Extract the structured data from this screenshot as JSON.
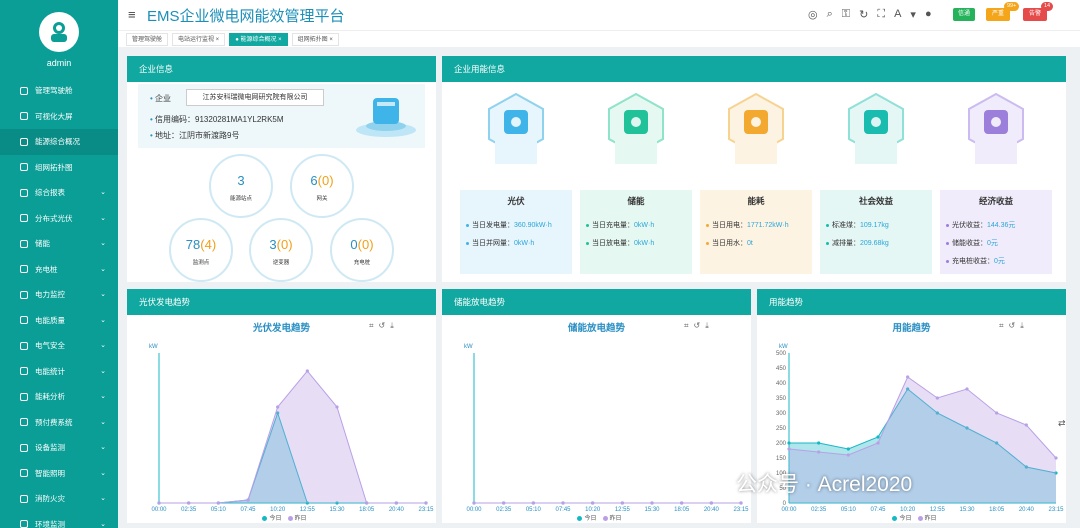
{
  "app": {
    "title": "EMS企业微电网能效管理平台",
    "user": "admin"
  },
  "top": {
    "btn_green": "信通",
    "btn_orange": "严重",
    "btn_red": "告警",
    "badge_orange": "99+",
    "badge_red": "14"
  },
  "sidebar": [
    {
      "label": "管理驾驶舱"
    },
    {
      "label": "可视化大屏"
    },
    {
      "label": "能源综合概况",
      "active": true
    },
    {
      "label": "组网拓扑图"
    },
    {
      "label": "综合报表",
      "caret": true
    },
    {
      "label": "分布式光伏",
      "caret": true
    },
    {
      "label": "储能",
      "caret": true
    },
    {
      "label": "充电桩",
      "caret": true
    },
    {
      "label": "电力监控",
      "caret": true
    },
    {
      "label": "电能质量",
      "caret": true
    },
    {
      "label": "电气安全",
      "caret": true
    },
    {
      "label": "电能统计",
      "caret": true
    },
    {
      "label": "能耗分析",
      "caret": true
    },
    {
      "label": "预付费系统",
      "caret": true
    },
    {
      "label": "设备监测",
      "caret": true
    },
    {
      "label": "智能照明",
      "caret": true
    },
    {
      "label": "消防火灾",
      "caret": true
    },
    {
      "label": "环境监测",
      "caret": true
    }
  ],
  "tabs": [
    {
      "label": "管理驾驶舱"
    },
    {
      "label": "电站运行监视 ×"
    },
    {
      "label": "● 能源综合概况 ×",
      "active": true
    },
    {
      "label": "组网拓扑图 ×"
    }
  ],
  "company": {
    "panel_title": "企业信息",
    "label": "企业",
    "name": "江苏安科瑞微电网研究院有限公司",
    "credit": "信用编码：91320281MA1YL2RK5M",
    "address": "地址：江阴市新渡路9号"
  },
  "stats": [
    {
      "value": "3",
      "sub": "",
      "label": "能源站点"
    },
    {
      "value": "6",
      "sub": "0",
      "label": "网关"
    },
    {
      "value": "78",
      "sub": "4",
      "label": "监测点"
    },
    {
      "value": "3",
      "sub": "0",
      "label": "逆变器"
    },
    {
      "value": "0",
      "sub": "0",
      "label": "充电桩"
    }
  ],
  "energy": {
    "panel_title": "企业用能信息",
    "cards": [
      {
        "title": "光伏",
        "rows": [
          {
            "k": "当日发电量：",
            "v": "360.90kW·h"
          },
          {
            "k": "当日并网量：",
            "v": "0kW·h"
          }
        ]
      },
      {
        "title": "储能",
        "rows": [
          {
            "k": "当日充电量：",
            "v": "0kW·h"
          },
          {
            "k": "当日放电量：",
            "v": "0kW·h"
          }
        ]
      },
      {
        "title": "能耗",
        "rows": [
          {
            "k": "当日用电：",
            "v": "1771.72kW·h"
          },
          {
            "k": "当日用水：",
            "v": "0t"
          }
        ]
      },
      {
        "title": "社会效益",
        "rows": [
          {
            "k": "标准煤：",
            "v": "109.17kg"
          },
          {
            "k": "减排量：",
            "v": "209.68kg"
          }
        ]
      },
      {
        "title": "经济收益",
        "rows": [
          {
            "k": "光伏收益：",
            "v": "144.36元"
          },
          {
            "k": "储能收益：",
            "v": "0元"
          },
          {
            "k": "充电桩收益：",
            "v": "0元"
          }
        ]
      }
    ]
  },
  "panels": {
    "pv": "光伏发电趋势",
    "storage": "储能放电趋势",
    "usage": "用能趋势"
  },
  "watermark": "公众号 · Acrel2020",
  "chart_data": [
    {
      "type": "area",
      "title": "光伏发电趋势",
      "ylabel": "kW",
      "ylim": [
        0,
        250
      ],
      "x": [
        "00:00",
        "02:35",
        "05:10",
        "07:45",
        "10:20",
        "12:55",
        "15:30",
        "18:05",
        "20:40",
        "23:15"
      ],
      "series": [
        {
          "name": "今日",
          "values": [
            0,
            0,
            0,
            5,
            150,
            0,
            0,
            0,
            0,
            0
          ]
        },
        {
          "name": "昨日",
          "values": [
            0,
            0,
            0,
            5,
            160,
            220,
            160,
            0,
            0,
            0
          ]
        }
      ]
    },
    {
      "type": "area",
      "title": "储能放电趋势",
      "ylabel": "kW",
      "ylim": [
        0,
        1
      ],
      "x": [
        "00:00",
        "02:35",
        "05:10",
        "07:45",
        "10:20",
        "12:55",
        "15:30",
        "18:05",
        "20:40",
        "23:15"
      ],
      "series": [
        {
          "name": "今日",
          "values": [
            0,
            0,
            0,
            0,
            0,
            0,
            0,
            0,
            0,
            0
          ]
        },
        {
          "name": "昨日",
          "values": [
            0,
            0,
            0,
            0,
            0,
            0,
            0,
            0,
            0,
            0
          ]
        }
      ]
    },
    {
      "type": "area",
      "title": "用能趋势",
      "ylabel": "kW",
      "ylim": [
        0,
        500
      ],
      "x": [
        "00:00",
        "02:35",
        "05:10",
        "07:45",
        "10:20",
        "12:55",
        "15:30",
        "18:05",
        "20:40",
        "23:15"
      ],
      "yticks": [
        0,
        50,
        100,
        150,
        200,
        250,
        300,
        350,
        400,
        450,
        500
      ],
      "series": [
        {
          "name": "今日",
          "values": [
            200,
            200,
            180,
            220,
            380,
            300,
            250,
            200,
            120,
            100
          ]
        },
        {
          "name": "昨日",
          "values": [
            180,
            170,
            160,
            200,
            420,
            350,
            380,
            300,
            260,
            150
          ]
        }
      ]
    }
  ]
}
